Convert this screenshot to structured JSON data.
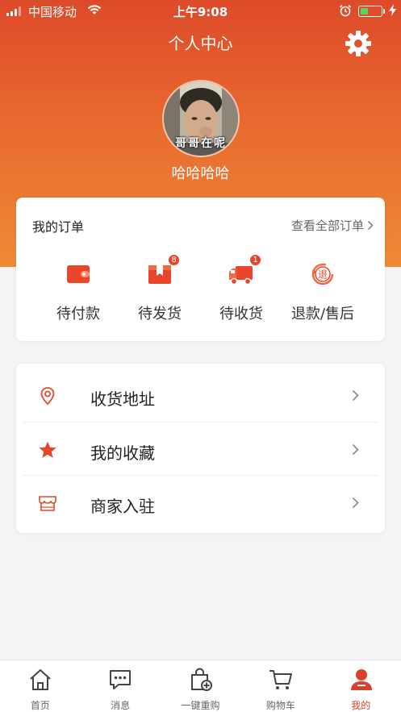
{
  "status_bar": {
    "carrier": "中国移动",
    "time": "上午9:08"
  },
  "header": {
    "title": "个人中心"
  },
  "profile": {
    "username": "哈哈哈哈",
    "avatar_caption": "哥哥在呢"
  },
  "orders": {
    "title": "我的订单",
    "view_all": "查看全部订单",
    "items": [
      {
        "label": "待付款",
        "icon": "wallet-icon"
      },
      {
        "label": "待发货",
        "icon": "package-icon",
        "badge": "8"
      },
      {
        "label": "待收货",
        "icon": "truck-icon",
        "badge": "1"
      },
      {
        "label": "退款/售后",
        "icon": "refund-icon",
        "glyph": "退"
      }
    ]
  },
  "menu": {
    "items": [
      {
        "label": "收货地址",
        "icon": "location-pin-icon"
      },
      {
        "label": "我的收藏",
        "icon": "star-icon"
      },
      {
        "label": "商家入驻",
        "icon": "storefront-icon"
      }
    ]
  },
  "tabbar": {
    "items": [
      {
        "label": "首页",
        "icon": "home-icon"
      },
      {
        "label": "消息",
        "icon": "message-icon"
      },
      {
        "label": "一键重购",
        "icon": "bag-plus-icon"
      },
      {
        "label": "购物车",
        "icon": "cart-icon"
      },
      {
        "label": "我的",
        "icon": "user-icon",
        "active": true
      }
    ]
  },
  "colors": {
    "accent": "#e8452a",
    "header_top": "#dd4a2a",
    "header_bottom": "#ef8a35"
  }
}
